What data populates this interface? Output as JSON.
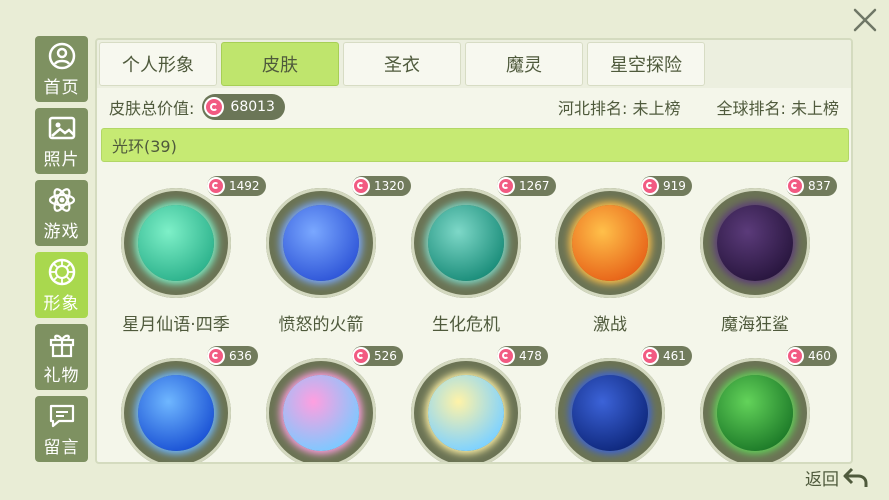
{
  "sidebar": {
    "items": [
      {
        "label": "首页",
        "icon": "person-icon",
        "active": false
      },
      {
        "label": "照片",
        "icon": "photo-icon",
        "active": false
      },
      {
        "label": "游戏",
        "icon": "atom-icon",
        "active": false
      },
      {
        "label": "形象",
        "icon": "ring-icon",
        "active": true
      },
      {
        "label": "礼物",
        "icon": "gift-icon",
        "active": false
      },
      {
        "label": "留言",
        "icon": "message-icon",
        "active": false
      }
    ]
  },
  "tabs": [
    {
      "label": "个人形象",
      "active": false
    },
    {
      "label": "皮肤",
      "active": true
    },
    {
      "label": "圣衣",
      "active": false
    },
    {
      "label": "魔灵",
      "active": false
    },
    {
      "label": "星空探险",
      "active": false
    }
  ],
  "info": {
    "total_label": "皮肤总价值:",
    "total_value": "68013",
    "province_rank": "河北排名: 未上榜",
    "global_rank": "全球排名: 未上榜"
  },
  "section": {
    "title": "光环(39)"
  },
  "items": [
    {
      "name": "星月仙语·四季",
      "price": "1492",
      "colors": [
        "#7ef0c8",
        "#2fb48e"
      ]
    },
    {
      "name": "愤怒的火箭",
      "price": "1320",
      "colors": [
        "#7aa8ff",
        "#3158d9"
      ]
    },
    {
      "name": "生化危机",
      "price": "1267",
      "colors": [
        "#7ed8c8",
        "#1d8f7c"
      ]
    },
    {
      "name": "激战",
      "price": "919",
      "colors": [
        "#ffc04a",
        "#e8661a"
      ]
    },
    {
      "name": "魔海狂鲨",
      "price": "837",
      "colors": [
        "#5b3b7a",
        "#2a1740"
      ]
    },
    {
      "name": "",
      "price": "636",
      "colors": [
        "#6fb7ff",
        "#1d55d6"
      ]
    },
    {
      "name": "",
      "price": "526",
      "colors": [
        "#ff9fe0",
        "#7fc8ff"
      ]
    },
    {
      "name": "",
      "price": "478",
      "colors": [
        "#fff3a8",
        "#7fd2ff"
      ]
    },
    {
      "name": "",
      "price": "461",
      "colors": [
        "#3c63d8",
        "#102a80"
      ]
    },
    {
      "name": "",
      "price": "460",
      "colors": [
        "#63d35a",
        "#1f7d2a"
      ]
    }
  ],
  "back": {
    "label": "返回"
  },
  "colors": {
    "accent": "#bfe56d",
    "sidebar": "#7e9161",
    "active_sidebar": "#a9d84e",
    "gem": "#f25a82"
  }
}
